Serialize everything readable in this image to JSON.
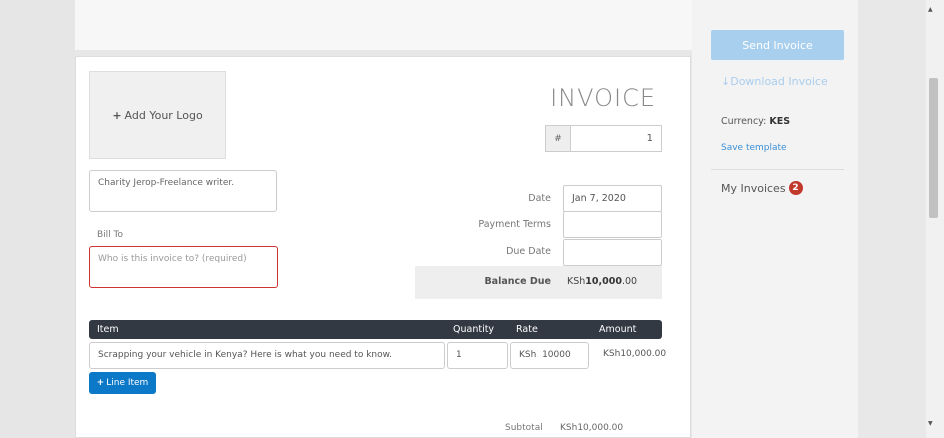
{
  "header": {
    "logo_plus": "+",
    "logo_label": "Add Your Logo",
    "title": "INVOICE",
    "number_prefix": "#",
    "number_value": "1"
  },
  "from": {
    "value": "Charity Jerop-Freelance writer."
  },
  "bill_to": {
    "label": "Bill To",
    "placeholder": "Who is this invoice to? (required)"
  },
  "meta": {
    "date_label": "Date",
    "date_value": "Jan 7, 2020",
    "terms_label": "Payment Terms",
    "terms_value": "",
    "due_label": "Due Date",
    "due_value": "",
    "balance_label": "Balance Due",
    "balance_currency": "KSh",
    "balance_amount": "10,000",
    "balance_cents": ".00"
  },
  "items": {
    "headers": {
      "item": "Item",
      "quantity": "Quantity",
      "rate": "Rate",
      "amount": "Amount"
    },
    "rows": [
      {
        "description": "Scrapping your vehicle in Kenya? Here is what you need to know.",
        "quantity": "1",
        "rate_currency": "KSh",
        "rate": "10000",
        "amount": "KSh10,000.00"
      }
    ],
    "add_line_plus": "+",
    "add_line_label": "Line Item"
  },
  "totals": {
    "subtotal_label": "Subtotal",
    "subtotal_value": "KSh10,000.00"
  },
  "sidebar": {
    "send_label": "Send Invoice",
    "download_icon": "↓",
    "download_label": "Download Invoice",
    "currency_label": "Currency:",
    "currency_value": "KES",
    "save_template_label": "Save template",
    "my_invoices_label": "My Invoices",
    "my_invoices_count": "2"
  },
  "scroll": {
    "up_arrow": "▲",
    "down_arrow": "▼"
  },
  "colors": {
    "accent_blue": "#0b78c8",
    "send_button": "#a8cfee",
    "header_dark": "#323943",
    "badge_red": "#c0392b",
    "required_border": "#cc3333"
  }
}
